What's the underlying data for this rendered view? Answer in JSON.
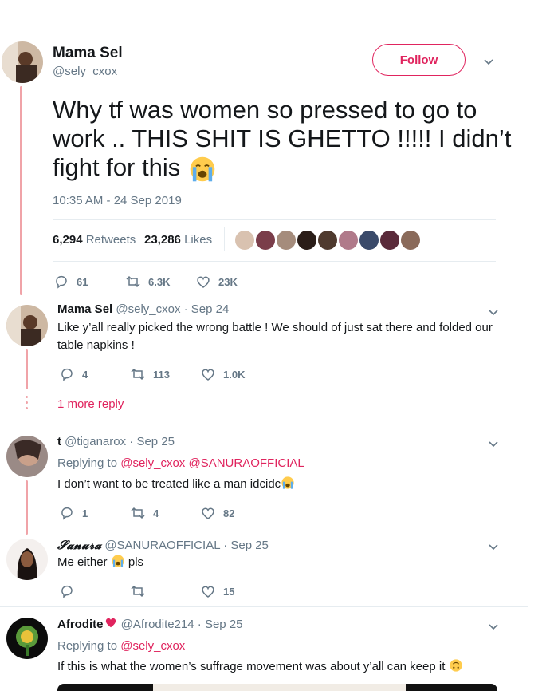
{
  "main_tweet": {
    "author_name": "Mama Sel",
    "author_handle": "@sely_cxox",
    "follow_label": "Follow",
    "text": "Why tf was women so pressed to go to work .. THIS SHIT IS GHETTO !!!!! I didn’t fight for this",
    "text_line1": "Why tf was women so pressed to go to",
    "text_line2": "work .. THIS SHIT IS GHETTO !!!!! I didn’t",
    "text_line3": "fight for this",
    "timestamp": "10:35 AM - 24 Sep 2019",
    "retweets_count": "6,294",
    "retweets_label": "Retweets",
    "likes_count": "23,286",
    "likes_label": "Likes",
    "reply_count": "61",
    "retweet_count_short": "6.3K",
    "like_count_short": "23K"
  },
  "replies": [
    {
      "name": "Mama Sel",
      "handle": "@sely_cxox",
      "date": "· Sep 24",
      "text": "Like y’all really picked the wrong battle ! We should of just sat there and folded our table napkins !",
      "reply_count": "4",
      "retweet_count": "113",
      "like_count": "1.0K",
      "more_replies": "1 more reply"
    },
    {
      "name": "t",
      "handle": "@tiganarox",
      "date": "· Sep 25",
      "replying_label": "Replying to",
      "replying_to": "@sely_cxox @SANURAOFFICIAL",
      "text": "I don’t want to be treated like a man idcidc",
      "reply_count": "1",
      "retweet_count": "4",
      "like_count": "82"
    },
    {
      "name": "𝓢𝓪𝓷𝓾𝓻𝓪",
      "handle": "@SANURAOFFICIAL",
      "date": "· Sep 25",
      "text_before": "Me either",
      "text_after": "pls",
      "like_count": "15"
    },
    {
      "name": "Afrodite",
      "handle": "@Afrodite214",
      "date": "· Sep 25",
      "replying_label": "Replying to",
      "replying_to": "@sely_cxox",
      "text": "If this is what the women’s suffrage movement was about y’all can keep it"
    }
  ],
  "colors": {
    "accent": "#e0245e",
    "thread_line": "#f0a3a8",
    "muted": "#657786"
  },
  "icons": [
    "chevron-down-icon",
    "reply-icon",
    "retweet-icon",
    "heart-icon",
    "crying-emoji-icon",
    "upside-down-emoji-icon",
    "heart-emoji-icon"
  ]
}
